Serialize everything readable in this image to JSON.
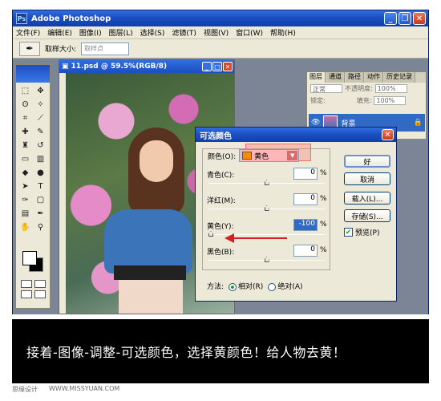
{
  "window": {
    "title": "Adobe Photoshop"
  },
  "menu": [
    "文件(F)",
    "编辑(E)",
    "图像(I)",
    "图层(L)",
    "选择(S)",
    "滤镜(T)",
    "视图(V)",
    "窗口(W)",
    "帮助(H)"
  ],
  "options": {
    "sample_label": "取样大小:",
    "sample_value": "取样点"
  },
  "document": {
    "title": "11.psd @ 59.5%(RGB/8)"
  },
  "layers": {
    "tabs": [
      "图层",
      "通道",
      "路径",
      "动作",
      "历史记录"
    ],
    "blend": "正常",
    "opacity_label": "不透明度:",
    "opacity": "100%",
    "lock_label": "锁定:",
    "fill_label": "填充:",
    "fill": "100%",
    "layer_name": "背景"
  },
  "dialog": {
    "title": "可选颜色",
    "color_label": "颜色(O):",
    "color_value": "黄色",
    "sliders": [
      {
        "label": "青色(C):",
        "value": "0",
        "unit": "%",
        "knob": 0.5
      },
      {
        "label": "洋红(M):",
        "value": "0",
        "unit": "%",
        "knob": 0.5
      },
      {
        "label": "黄色(Y):",
        "value": "-100",
        "unit": "%",
        "knob": 0.0
      },
      {
        "label": "黑色(B):",
        "value": "0",
        "unit": "%",
        "knob": 0.5
      }
    ],
    "ok": "好",
    "cancel": "取消",
    "load": "载入(L)...",
    "save": "存储(S)...",
    "preview": "预览(P)",
    "method_label": "方法:",
    "relative": "相对(R)",
    "absolute": "绝对(A)"
  },
  "caption": "接着-图像-调整-可选颜色，选择黄颜色！给人物去黄！",
  "footer": [
    "思缘设计",
    "WWW.MISSYUAN.COM"
  ],
  "colors": {
    "accent": "#1b4ebf",
    "highlight": "#ff6666",
    "arrow": "#d62020"
  }
}
